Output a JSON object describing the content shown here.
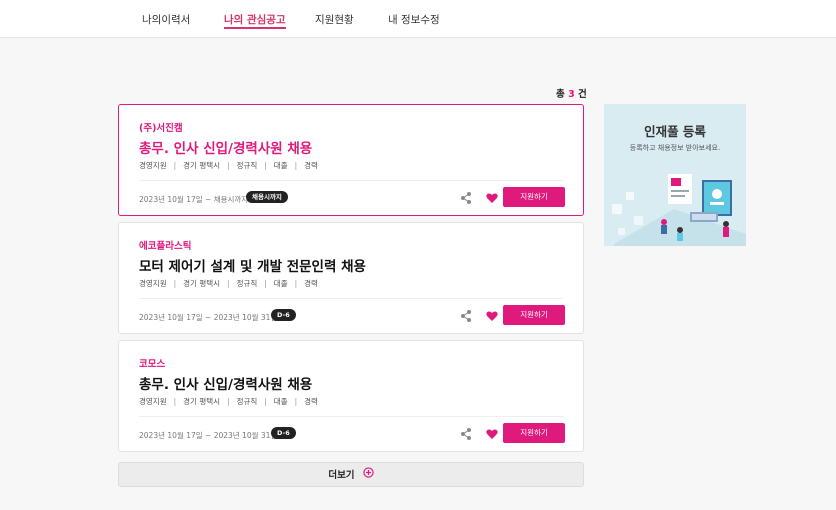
{
  "nav": {
    "tabs": [
      {
        "label": "나의이력서"
      },
      {
        "label": "나의 관심공고",
        "active": true
      },
      {
        "label": "지원현황"
      },
      {
        "label": "내 정보수정"
      }
    ]
  },
  "summary": {
    "prefix": "총",
    "count": "3",
    "suffix": "건"
  },
  "jobs": [
    {
      "company": "(주)서진캠",
      "title": "총무. 인사 신입/경력사원 채용",
      "meta": [
        "경영지원",
        "경기 평택시",
        "정규직",
        "대졸",
        "경력"
      ],
      "period": "2023년 10월 17일 ~ 채용시까지",
      "badge": "채용시까지",
      "apply_label": "지원하기",
      "liked": true,
      "highlighted": true
    },
    {
      "company": "에코플라스틱",
      "title": "모터 제어기 설계 및 개발 전문인력 채용",
      "meta": [
        "경영지원",
        "경기 평택시",
        "정규직",
        "대졸",
        "경력"
      ],
      "period": "2023년 10월 17일 ~ 2023년 10월 31일",
      "badge": "D-6",
      "apply_label": "지원하기",
      "liked": true,
      "highlighted": false
    },
    {
      "company": "코모스",
      "title": "총무. 인사 신입/경력사원 채용",
      "meta": [
        "경영지원",
        "경기 평택시",
        "정규직",
        "대졸",
        "경력"
      ],
      "period": "2023년 10월 17일 ~ 2023년 10월 31일",
      "badge": "D-6",
      "apply_label": "지원하기",
      "liked": true,
      "highlighted": false
    }
  ],
  "more_button": {
    "label": "더보기",
    "icon": "plus-circle-icon"
  },
  "banner": {
    "title": "인재풀 등록",
    "subtitle": "등록하고 채용정보 받아보세요."
  },
  "colors": {
    "accent": "#e0197d",
    "badge_bg": "#222222"
  }
}
